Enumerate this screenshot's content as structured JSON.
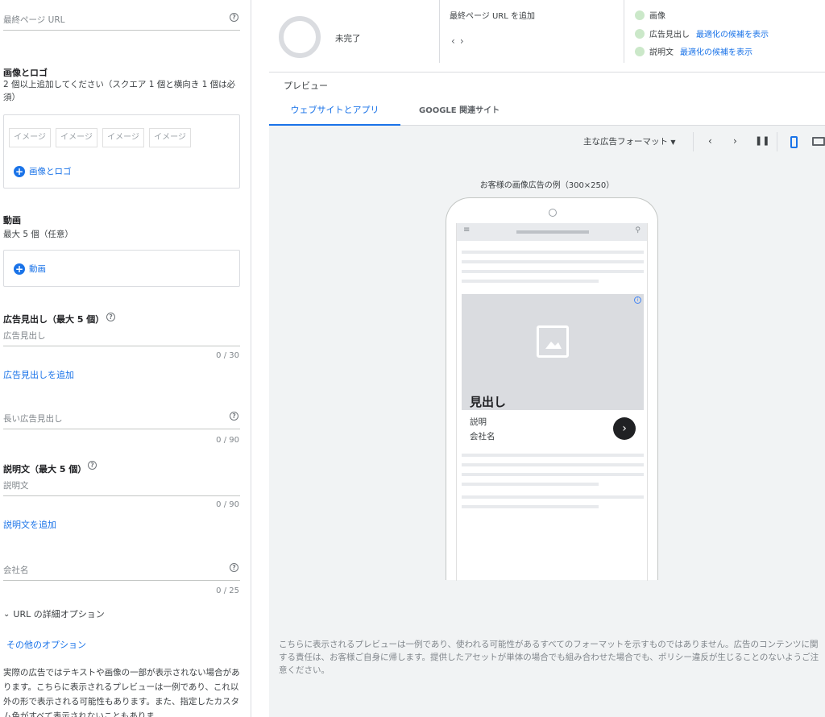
{
  "left": {
    "final_url_placeholder": "最終ページ URL",
    "images": {
      "title": "画像とロゴ",
      "desc": "2 個以上追加してください（スクエア 1 個と横向き 1 個は必須）",
      "slot_label": "イメージ",
      "add_label": "画像とロゴ"
    },
    "video": {
      "title": "動画",
      "desc": "最大 5 個（任意）",
      "add_label": "動画"
    },
    "headline": {
      "title": "広告見出し（最大 5 個）",
      "placeholder": "広告見出し",
      "count": "0 / 30",
      "add_link": "広告見出しを追加"
    },
    "long_headline": {
      "placeholder": "長い広告見出し",
      "count": "0 / 90"
    },
    "description": {
      "title": "説明文（最大 5 個）",
      "placeholder": "説明文",
      "count": "0 / 90",
      "add_link": "説明文を追加"
    },
    "business_name": {
      "placeholder": "会社名",
      "count": "0 / 25"
    },
    "url_options": "URL の詳細オプション",
    "more_options": "その他のオプション",
    "note": "実際の広告ではテキストや画像の一部が表示されない場合があります。こちらに表示されるプレビューは一例であり、これ以外の形で表示される可能性もあります。また、指定したカスタム色がすべて表示されないこともありま"
  },
  "summary": {
    "status": "未完了",
    "final_url_add": "最終ページ URL を追加",
    "checklist": [
      {
        "label": "画像",
        "link": ""
      },
      {
        "label": "広告見出し",
        "link": "最適化の候補を表示"
      },
      {
        "label": "説明文",
        "link": "最適化の候補を表示"
      }
    ]
  },
  "preview": {
    "title": "プレビュー",
    "tabs": [
      "ウェブサイトとアプリ",
      "GOOGLE 関連サイト"
    ],
    "format_label": "主な広告フォーマット",
    "example_label": "お客様の画像広告の例（300×250）",
    "ad": {
      "headline": "見出し",
      "description": "説明",
      "business": "会社名"
    }
  },
  "disclaimer": "こちらに表示されるプレビューは一例であり、使われる可能性があるすべてのフォーマットを示すものではありません。広告のコンテンツに関する責任は、お客様ご自身に帰します。提供したアセットが単体の場合でも組み合わせた場合でも、ポリシー違反が生じることのないようご注意ください。",
  "colors": {
    "accent": "#1a73e8",
    "check_dot": "#cbe8c9"
  }
}
